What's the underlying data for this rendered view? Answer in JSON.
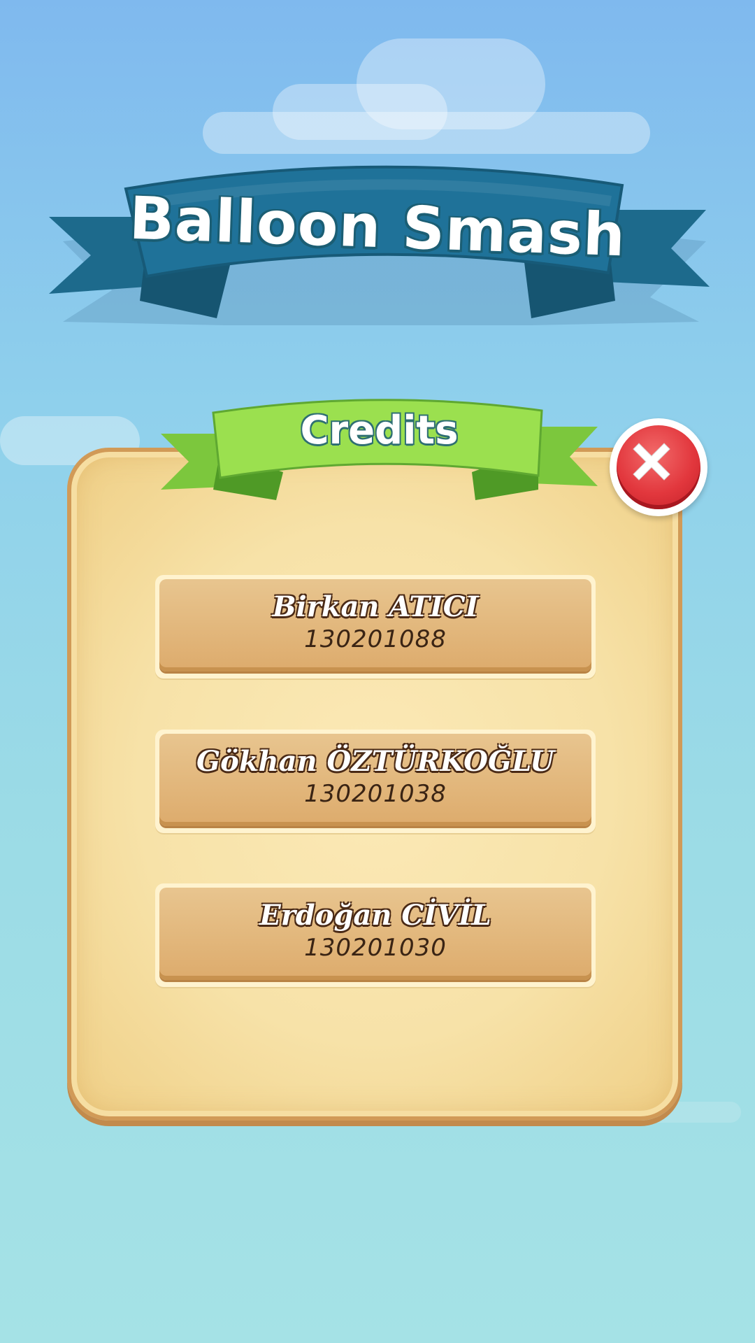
{
  "game": {
    "title": "Balloon Smash"
  },
  "credits_dialog": {
    "heading": "Credits",
    "close_icon": "close-x-icon",
    "entries": [
      {
        "name": "Birkan ATICI",
        "id": "130201088"
      },
      {
        "name": "Gökhan ÖZTÜRKOĞLU",
        "id": "130201038"
      },
      {
        "name": "Erdoğan CİVİL",
        "id": "130201030"
      }
    ]
  },
  "colors": {
    "title_ribbon": "#1e6f93",
    "credits_ribbon": "#8fd94e",
    "panel": "#f7e2a8",
    "close_button": "#e2373d",
    "entry_plate": "#ddab6c"
  }
}
